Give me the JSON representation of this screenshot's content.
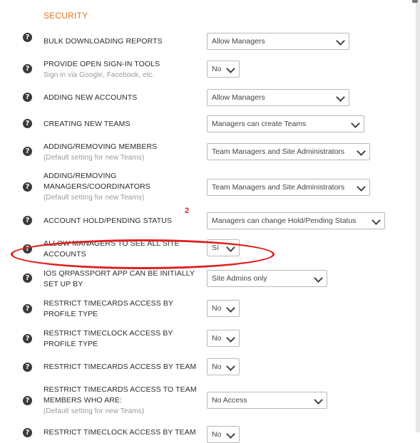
{
  "section": {
    "title": "SECURITY"
  },
  "annotation": {
    "number": "2"
  },
  "help_glyph": "?",
  "settings": [
    {
      "label": "BULK DOWNLOADING REPORTS",
      "value": "Allow Managers"
    },
    {
      "label": "PROVIDE OPEN SIGN-IN TOOLS",
      "sub": "Sign in via Google, Facebook, etc.",
      "value": "No"
    },
    {
      "label": "ADDING NEW ACCOUNTS",
      "value": "Allow Managers"
    },
    {
      "label": "CREATING NEW TEAMS",
      "value": "Managers can create Teams"
    },
    {
      "label": "ADDING/REMOVING MEMBERS",
      "sub": "(Default setting for new Teams)",
      "value": "Team Managers and Site Administrators"
    },
    {
      "label": "ADDING/REMOVING MANAGERS/COORDINATORS",
      "sub": "(Default setting for new Teams)",
      "value": "Team Managers and Site Administrators"
    },
    {
      "label": "ACCOUNT HOLD/PENDING STATUS",
      "value": "Managers can change Hold/Pending Status"
    },
    {
      "label": "ALLOW MANAGERS TO SEE ALL SITE ACCOUNTS",
      "value": "Sí"
    },
    {
      "label": "IOS QRPASSPORT APP CAN BE INITIALLY SET UP BY",
      "value": "Site Admins only"
    },
    {
      "label": "RESTRICT TIMECARDS ACCESS BY PROFILE TYPE",
      "value": "No"
    },
    {
      "label": "RESTRICT TIMECLOCK ACCESS BY PROFILE TYPE",
      "value": "No"
    },
    {
      "label": "RESTRICT TIMECARDS ACCESS BY TEAM",
      "value": "No"
    },
    {
      "label": "RESTRICT TIMECARDS ACCESS TO TEAM MEMBERS WHO ARE:",
      "sub": "(Default setting for new Teams)",
      "value": "No Access"
    },
    {
      "label": "RESTRICT TIMECLOCK ACCESS BY TEAM",
      "value": "No"
    }
  ]
}
